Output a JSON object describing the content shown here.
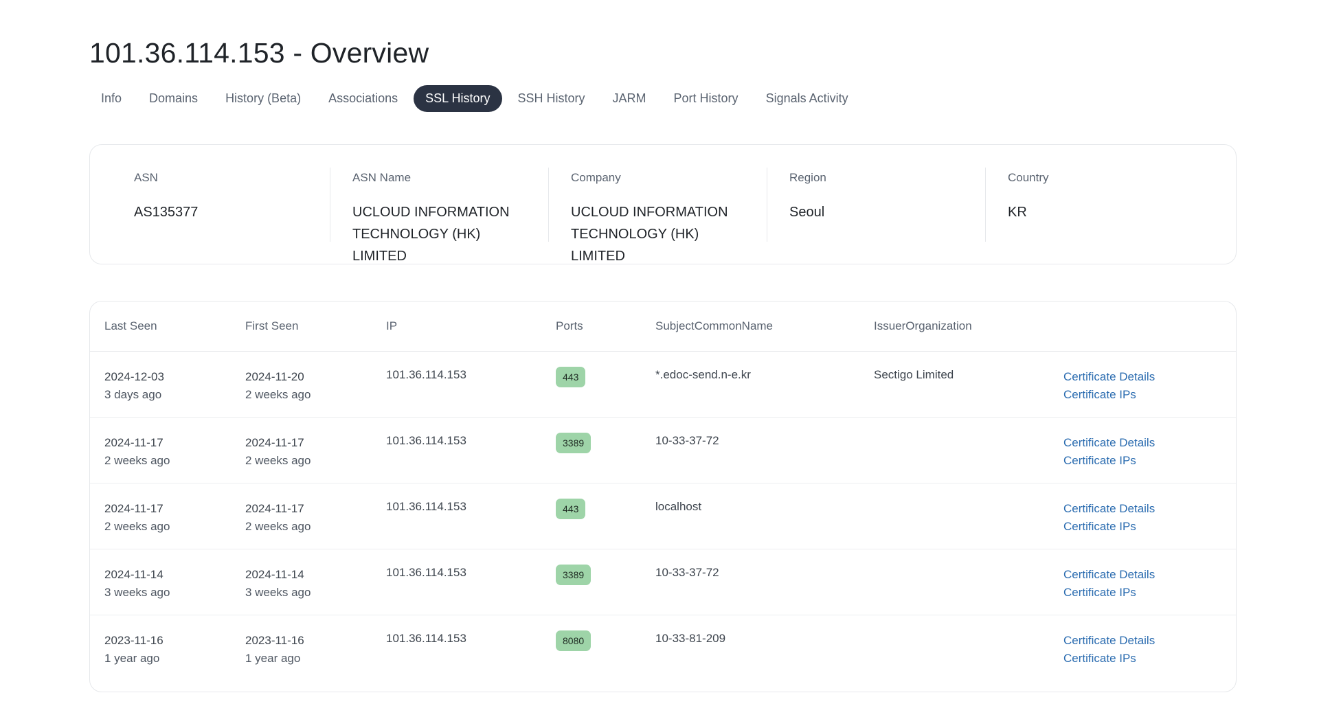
{
  "page": {
    "title": "101.36.114.153 - Overview"
  },
  "tabs": [
    {
      "label": "Info",
      "active": false
    },
    {
      "label": "Domains",
      "active": false
    },
    {
      "label": "History (Beta)",
      "active": false
    },
    {
      "label": "Associations",
      "active": false
    },
    {
      "label": "SSL History",
      "active": true
    },
    {
      "label": "SSH History",
      "active": false
    },
    {
      "label": "JARM",
      "active": false
    },
    {
      "label": "Port History",
      "active": false
    },
    {
      "label": "Signals Activity",
      "active": false
    }
  ],
  "info": {
    "asn": {
      "label": "ASN",
      "value": "AS135377"
    },
    "asn_name": {
      "label": "ASN Name",
      "value": "UCLOUD INFORMATION TECHNOLOGY (HK) LIMITED"
    },
    "company": {
      "label": "Company",
      "value": "UCLOUD INFORMATION TECHNOLOGY (HK) LIMITED"
    },
    "region": {
      "label": "Region",
      "value": "Seoul"
    },
    "country": {
      "label": "Country",
      "value": "KR"
    }
  },
  "table": {
    "headers": {
      "last_seen": "Last Seen",
      "first_seen": "First Seen",
      "ip": "IP",
      "ports": "Ports",
      "subject": "SubjectCommonName",
      "issuer": "IssuerOrganization"
    },
    "rows": [
      {
        "last_seen": "2024-12-03",
        "last_seen_rel": "3 days ago",
        "first_seen": "2024-11-20",
        "first_seen_rel": "2 weeks ago",
        "ip": "101.36.114.153",
        "port": "443",
        "subject": "*.edoc-send.n-e.kr",
        "issuer": "Sectigo Limited",
        "details_link": "Certificate Details",
        "ips_link": "Certificate IPs"
      },
      {
        "last_seen": "2024-11-17",
        "last_seen_rel": "2 weeks ago",
        "first_seen": "2024-11-17",
        "first_seen_rel": "2 weeks ago",
        "ip": "101.36.114.153",
        "port": "3389",
        "subject": "10-33-37-72",
        "issuer": "",
        "details_link": "Certificate Details",
        "ips_link": "Certificate IPs"
      },
      {
        "last_seen": "2024-11-17",
        "last_seen_rel": "2 weeks ago",
        "first_seen": "2024-11-17",
        "first_seen_rel": "2 weeks ago",
        "ip": "101.36.114.153",
        "port": "443",
        "subject": "localhost",
        "issuer": "",
        "details_link": "Certificate Details",
        "ips_link": "Certificate IPs"
      },
      {
        "last_seen": "2024-11-14",
        "last_seen_rel": "3 weeks ago",
        "first_seen": "2024-11-14",
        "first_seen_rel": "3 weeks ago",
        "ip": "101.36.114.153",
        "port": "3389",
        "subject": "10-33-37-72",
        "issuer": "",
        "details_link": "Certificate Details",
        "ips_link": "Certificate IPs"
      },
      {
        "last_seen": "2023-11-16",
        "last_seen_rel": "1 year ago",
        "first_seen": "2023-11-16",
        "first_seen_rel": "1 year ago",
        "ip": "101.36.114.153",
        "port": "8080",
        "subject": "10-33-81-209",
        "issuer": "",
        "details_link": "Certificate Details",
        "ips_link": "Certificate IPs"
      }
    ]
  },
  "colors": {
    "active_tab_bg": "#2b3343",
    "port_badge_bg": "#9ed4a8",
    "link": "#2b6cb0"
  }
}
